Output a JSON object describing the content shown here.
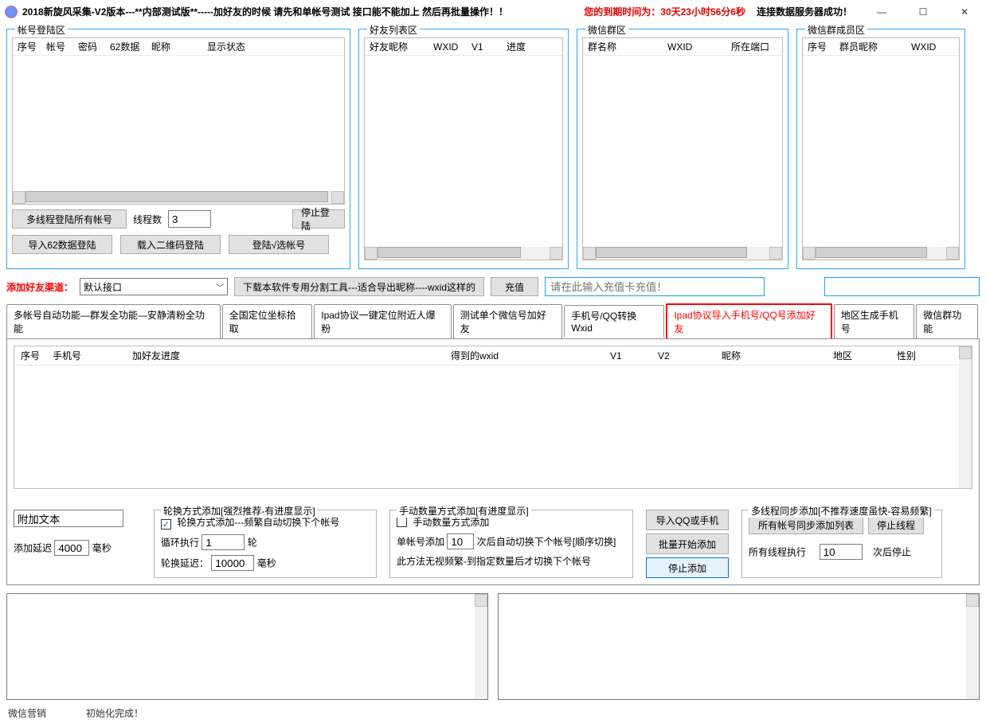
{
  "title_bar": {
    "title": "2018新旋风采集-V2版本---**内部测试版**-----加好友的时候 请先和单帐号测试 接口能不能加上 然后再批量操作！！",
    "expiry": "您的到期时间为：30天23小时56分6秒",
    "connection": "连接数据服务器成功！"
  },
  "group_titles": {
    "login": "帐号登陆区",
    "friends": "好友列表区",
    "groups": "微信群区",
    "members": "微信群成员区"
  },
  "login": {
    "cols": [
      "序号",
      "帐号",
      "密码",
      "62数据",
      "昵称",
      "显示状态"
    ],
    "multi_login_btn": "多线程登陆所有帐号",
    "thread_label": "线程数",
    "thread_value": "3",
    "stop_login_btn": "停止登陆",
    "import62_btn": "导入62数据登陆",
    "qr_btn": "载入二维码登陆",
    "login_sel_btn": "登陆√选帐号"
  },
  "friends": {
    "cols": [
      "好友昵称",
      "WXID",
      "V1",
      "进度"
    ]
  },
  "groups": {
    "cols": [
      "群名称",
      "WXID",
      "所在端口"
    ]
  },
  "members": {
    "cols": [
      "序号",
      "群员昵称",
      "WXID"
    ]
  },
  "channel": {
    "label": "添加好友渠道：",
    "selected": "默认接口",
    "tool_btn": "下载本软件专用分割工具---适合导出昵称----wxid这样的",
    "recharge_btn": "充值",
    "recharge_placeholder": "请在此输入充值卡充值！"
  },
  "tabs": [
    "多帐号自动功能―群发全功能―安静清粉全功能",
    "全国定位坐标拾取",
    "Ipad协议一键定位附近人爆粉",
    "测试单个微信号加好友",
    "手机号/QQ转换Wxid",
    "Ipad协议导入手机号/QQ号添加好友",
    "地区生成手机号",
    "微信群功能"
  ],
  "active_tab_index": 5,
  "big_grid_cols": [
    "序号",
    "手机号",
    "加好友进度",
    "得到的wxid",
    "V1",
    "V2",
    "昵称",
    "地区",
    "性别"
  ],
  "opt1": {
    "attach_placeholder": "附加文本",
    "delay_label": "添加延迟",
    "delay_value": "4000",
    "delay_unit": "毫秒"
  },
  "rotate_fs": {
    "legend": "轮换方式添加[强烈推荐-有进度显示]",
    "cb_label": "轮换方式添加---频繁自动切换下个帐号",
    "cb_checked": true,
    "loop_exec": "循环执行",
    "loop_value": "1",
    "loop_unit": "轮",
    "rot_delay": "轮换延迟：",
    "rot_value": "10000",
    "rot_unit": "毫秒"
  },
  "manual_fs": {
    "legend": "手动数量方式添加[有进度显示]",
    "cb_label": "手动数量方式添加",
    "cb_checked": false,
    "single_add": "单帐号添加",
    "single_value": "10",
    "single_tail": "次后自动切换下个帐号[顺序切换]",
    "note": "此方法无视频繁-到指定数量后才切换下个帐号"
  },
  "btns_col": {
    "import_btn": "导入QQ或手机",
    "start_btn": "批量开始添加",
    "stop_btn": "停止添加"
  },
  "multi_fs": {
    "legend": "多线程同步添加[不推荐速度虽快-容易频繁]",
    "sync_btn": "所有帐号同步添加列表",
    "stop_thread_btn": "停止线程",
    "all_exec": "所有线程执行",
    "all_value": "10",
    "all_tail": "次后停止"
  },
  "status": {
    "left": "微信营销",
    "right": "初始化完成！"
  }
}
